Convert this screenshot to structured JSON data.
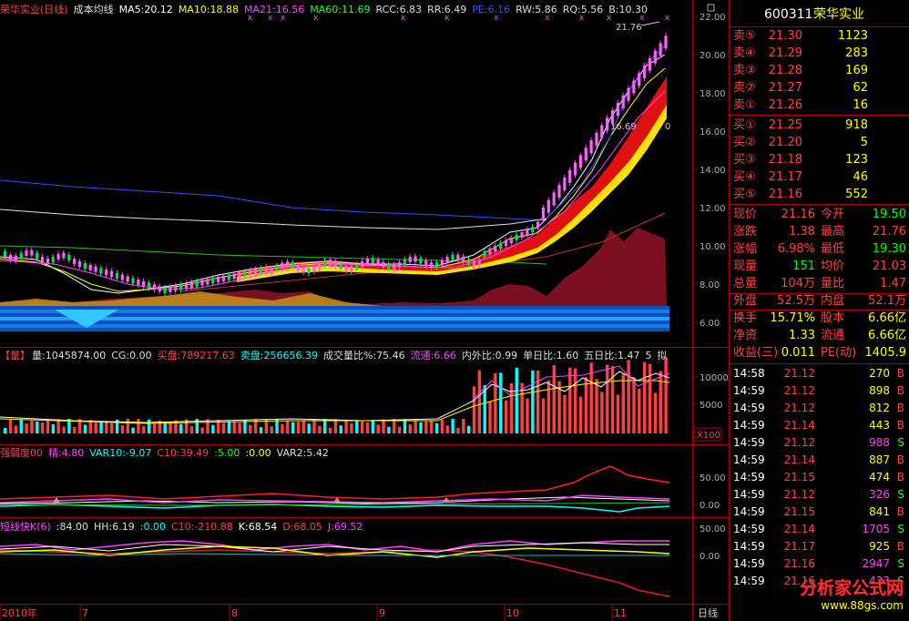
{
  "main_header": {
    "title": "荣华实业(日线)",
    "indicator_name": "成本均线",
    "ma5": "MA5:20.12",
    "ma10": "MA10:18.88",
    "ma21": "MA21:16.56",
    "ma60": "MA60:11.69",
    "rcc": "RCC:6.83",
    "rr": "RR:6.49",
    "pe": "PE:6.16",
    "rw": "RW:5.86",
    "rq": "RQ:5.56",
    "b": "B:10.30"
  },
  "price_axis": [
    "22.00",
    "20.00",
    "18.00",
    "16.00",
    "14.00",
    "12.00",
    "10.00",
    "8.00",
    "6.00"
  ],
  "price_annotations": {
    "high": "21.76",
    "low": "16.69"
  },
  "volume_header": {
    "name": "【量】",
    "vol": "量:1045874.00",
    "cg": "CG:0.00",
    "buy": "买盘:789217.63",
    "sell": "卖盘:256656.39",
    "ratio": "成交量比%:75.46",
    "flow": "流通:6.66",
    "inout": "内外比:0.99",
    "day_ratio": "单日比:1.60",
    "five_ratio": "五日比:1.47",
    "five": "5",
    "switch": "拟"
  },
  "volume_axis": [
    "10000",
    "5000"
  ],
  "volume_unit": "X100",
  "strength_header": {
    "name": "强弱度00",
    "jing": "精:4.80",
    "var10": "VAR10:-9.07",
    "c10": "C10:39.49",
    "v5": ":5.00",
    "v0": ":0.00",
    "var2": "VAR2:5.42"
  },
  "strength_axis": [
    "50.00",
    "0.00"
  ],
  "kdj_header": {
    "name": "短线快K(6)",
    "v84": ":84.00",
    "hh": "HH:6.19",
    "v0": ":0.00",
    "c10": "C10:-210.88",
    "k": "K:68.54",
    "d": "D:68.05",
    "j": "J:69.52"
  },
  "kdj_axis": [
    "50.00",
    "0.00"
  ],
  "time_axis": [
    "2010年",
    "7",
    "8",
    "9",
    "10",
    "11"
  ],
  "period_label": "日线",
  "quote": {
    "code": "600311",
    "name": "荣华实业",
    "asks": [
      {
        "label": "卖⑤",
        "price": "21.30",
        "vol": "1123"
      },
      {
        "label": "卖④",
        "price": "21.29",
        "vol": "283"
      },
      {
        "label": "卖③",
        "price": "21.28",
        "vol": "169"
      },
      {
        "label": "卖②",
        "price": "21.27",
        "vol": "62"
      },
      {
        "label": "卖①",
        "price": "21.26",
        "vol": "16"
      }
    ],
    "bids": [
      {
        "label": "买①",
        "price": "21.25",
        "vol": "918"
      },
      {
        "label": "买②",
        "price": "21.20",
        "vol": "5"
      },
      {
        "label": "买③",
        "price": "21.18",
        "vol": "123"
      },
      {
        "label": "买④",
        "price": "21.17",
        "vol": "46"
      },
      {
        "label": "买⑤",
        "price": "21.16",
        "vol": "552"
      }
    ],
    "stats": [
      {
        "l1": "现价",
        "v1": "21.16",
        "l2": "今开",
        "v2": "19.50"
      },
      {
        "l1": "涨跌",
        "v1": "1.38",
        "l2": "最高",
        "v2": "21.76"
      },
      {
        "l1": "涨幅",
        "v1": "6.98%",
        "l2": "最低",
        "v2": "19.30"
      },
      {
        "l1": "现量",
        "v1": "151",
        "l2": "均价",
        "v2": "21.03"
      },
      {
        "l1": "总量",
        "v1": "104万",
        "l2": "量比",
        "v2": "1.47"
      },
      {
        "l1": "外盘",
        "v1": "52.5万",
        "l2": "内盘",
        "v2": "52.1万"
      },
      {
        "l1": "换手",
        "v1": "15.71%",
        "l2": "股本",
        "v2": "6.66亿"
      },
      {
        "l1": "净资",
        "v1": "1.33",
        "l2": "流通",
        "v2": "6.66亿"
      },
      {
        "l1": "收益(三)",
        "v1": "0.011",
        "l2": "PE(动)",
        "v2": "1405.9"
      }
    ],
    "ticks": [
      {
        "t": "14:58",
        "p": "21.12",
        "v": "270",
        "d": "B"
      },
      {
        "t": "14:59",
        "p": "21.12",
        "v": "898",
        "d": "B"
      },
      {
        "t": "14:59",
        "p": "21.12",
        "v": "812",
        "d": "B"
      },
      {
        "t": "14:59",
        "p": "21.14",
        "v": "443",
        "d": "B"
      },
      {
        "t": "14:59",
        "p": "21.12",
        "v": "988",
        "d": "S"
      },
      {
        "t": "14:59",
        "p": "21.14",
        "v": "887",
        "d": "B"
      },
      {
        "t": "14:59",
        "p": "21.15",
        "v": "474",
        "d": "B"
      },
      {
        "t": "14:59",
        "p": "21.12",
        "v": "326",
        "d": "S"
      },
      {
        "t": "14:59",
        "p": "21.15",
        "v": "841",
        "d": "B"
      },
      {
        "t": "14:59",
        "p": "21.14",
        "v": "1705",
        "d": "S"
      },
      {
        "t": "14:59",
        "p": "21.17",
        "v": "925",
        "d": "B"
      },
      {
        "t": "14:59",
        "p": "21.16",
        "v": "2947",
        "d": "S"
      },
      {
        "t": "14:59",
        "p": "21.16",
        "v": "423",
        "d": "S"
      }
    ]
  },
  "watermark": {
    "title": "分析家公式网",
    "url": "www.88gs.com"
  },
  "colors": {
    "up": "#ff3c3c",
    "down": "#00ffff",
    "magenta": "#ff40ff",
    "yellow": "#ffff00",
    "red": "#ff0000",
    "price_red": "#ff4040",
    "green": "#00ff00"
  }
}
